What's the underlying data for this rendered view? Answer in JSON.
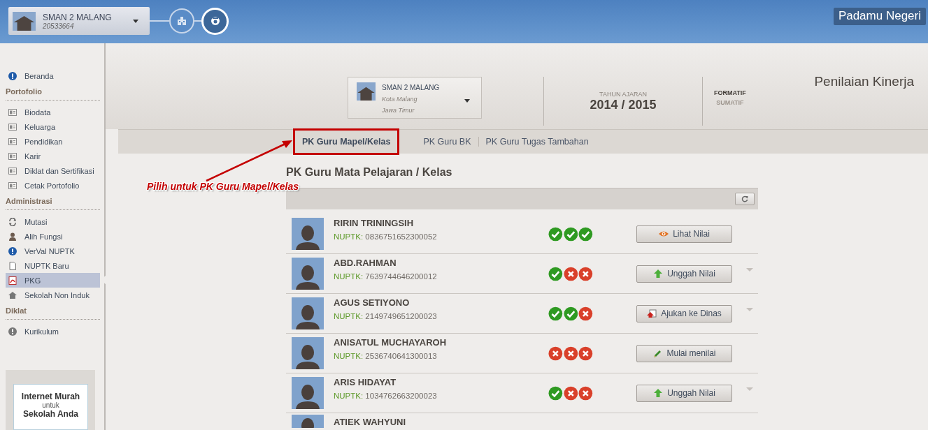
{
  "top_bar": {
    "school": {
      "name": "SMAN 2 MALANG",
      "code": "20533664"
    },
    "steps": [
      {
        "kind": "building",
        "selected": false
      },
      {
        "kind": "badge",
        "selected": true
      }
    ],
    "app_name": "Padamu Negeri"
  },
  "sidebar": {
    "top_items": [
      {
        "label": "Beranda",
        "kind": "info",
        "selected": false
      }
    ],
    "sections": [
      {
        "heading": "Portofolio",
        "items": [
          {
            "label": "Biodata",
            "kind": "card",
            "selected": false
          },
          {
            "label": "Keluarga",
            "kind": "card",
            "selected": false
          },
          {
            "label": "Pendidikan",
            "kind": "card",
            "selected": false
          },
          {
            "label": "Karir",
            "kind": "card",
            "selected": false
          },
          {
            "label": "Diklat dan Sertifikasi",
            "kind": "card",
            "selected": false
          },
          {
            "label": "Cetak Portofolio",
            "kind": "card",
            "selected": false
          }
        ]
      },
      {
        "heading": "Administrasi",
        "items": [
          {
            "label": "Mutasi",
            "kind": "cycle",
            "selected": false
          },
          {
            "label": "Alih Fungsi",
            "kind": "person",
            "selected": false
          },
          {
            "label": "VerVal NUPTK",
            "kind": "info",
            "selected": false
          },
          {
            "label": "NUPTK Baru",
            "kind": "document",
            "selected": false
          },
          {
            "label": "PKG",
            "kind": "pdf",
            "selected": true
          },
          {
            "label": "Sekolah Non Induk",
            "kind": "house",
            "selected": false
          }
        ]
      },
      {
        "heading": "Diklat",
        "items": [
          {
            "label": "Kurikulum",
            "kind": "alert",
            "selected": false
          }
        ]
      }
    ],
    "ad": {
      "line_1": "Internet Murah",
      "line_2": "untuk",
      "line_3": "Sekolah Anda"
    }
  },
  "header": {
    "school": {
      "name": "SMAN 2 MALANG",
      "city": "Kota Malang",
      "province": "Jawa Timur"
    },
    "academic_year": {
      "label": "TAHUN AJARAN",
      "value": "2014 / 2015"
    },
    "modes": [
      {
        "label": "FORMATIF",
        "selected": true
      },
      {
        "label": "SUMATIF",
        "selected": false
      }
    ],
    "page_title": "Penilaian Kinerja"
  },
  "tabs": [
    {
      "label": "PK Guru Mapel/Kelas",
      "selected": true,
      "annotated": true
    },
    {
      "label": "PK Guru BK",
      "selected": false,
      "annotated": false
    },
    {
      "label": "PK Guru Tugas Tambahan",
      "selected": false,
      "annotated": false
    }
  ],
  "annotation": {
    "text": "Pilih untuk PK Guru Mapel/Kelas"
  },
  "section_title": "PK Guru Mata Pelajaran / Kelas",
  "teachers": [
    {
      "name": "RIRIN TRININGSIH",
      "nuptk_label": "NUPTK:",
      "nuptk": "0836751652300052",
      "checks": [
        {
          "passed": true
        },
        {
          "passed": true
        },
        {
          "passed": true
        }
      ],
      "action": {
        "kind": "view",
        "label": "Lihat Nilai"
      },
      "has_menu": false
    },
    {
      "name": "ABD.RAHMAN",
      "nuptk_label": "NUPTK:",
      "nuptk": "7639744646200012",
      "checks": [
        {
          "passed": true
        },
        {
          "passed": false
        },
        {
          "passed": false
        }
      ],
      "action": {
        "kind": "upload",
        "label": "Unggah Nilai"
      },
      "has_menu": true
    },
    {
      "name": "AGUS SETIYONO",
      "nuptk_label": "NUPTK:",
      "nuptk": "2149749651200023",
      "checks": [
        {
          "passed": true
        },
        {
          "passed": true
        },
        {
          "passed": false
        }
      ],
      "action": {
        "kind": "submit",
        "label": "Ajukan ke Dinas"
      },
      "has_menu": true
    },
    {
      "name": "ANISATUL MUCHAYAROH",
      "nuptk_label": "NUPTK:",
      "nuptk": "2536740641300013",
      "checks": [
        {
          "passed": false
        },
        {
          "passed": false
        },
        {
          "passed": false
        }
      ],
      "action": {
        "kind": "edit",
        "label": "Mulai menilai"
      },
      "has_menu": false
    },
    {
      "name": "ARIS HIDAYAT",
      "nuptk_label": "NUPTK:",
      "nuptk": "1034762663200023",
      "checks": [
        {
          "passed": true
        },
        {
          "passed": false
        },
        {
          "passed": false
        }
      ],
      "action": {
        "kind": "upload",
        "label": "Unggah Nilai"
      },
      "has_menu": true
    },
    {
      "name": "ATIEK WAHYUNI"
    }
  ]
}
